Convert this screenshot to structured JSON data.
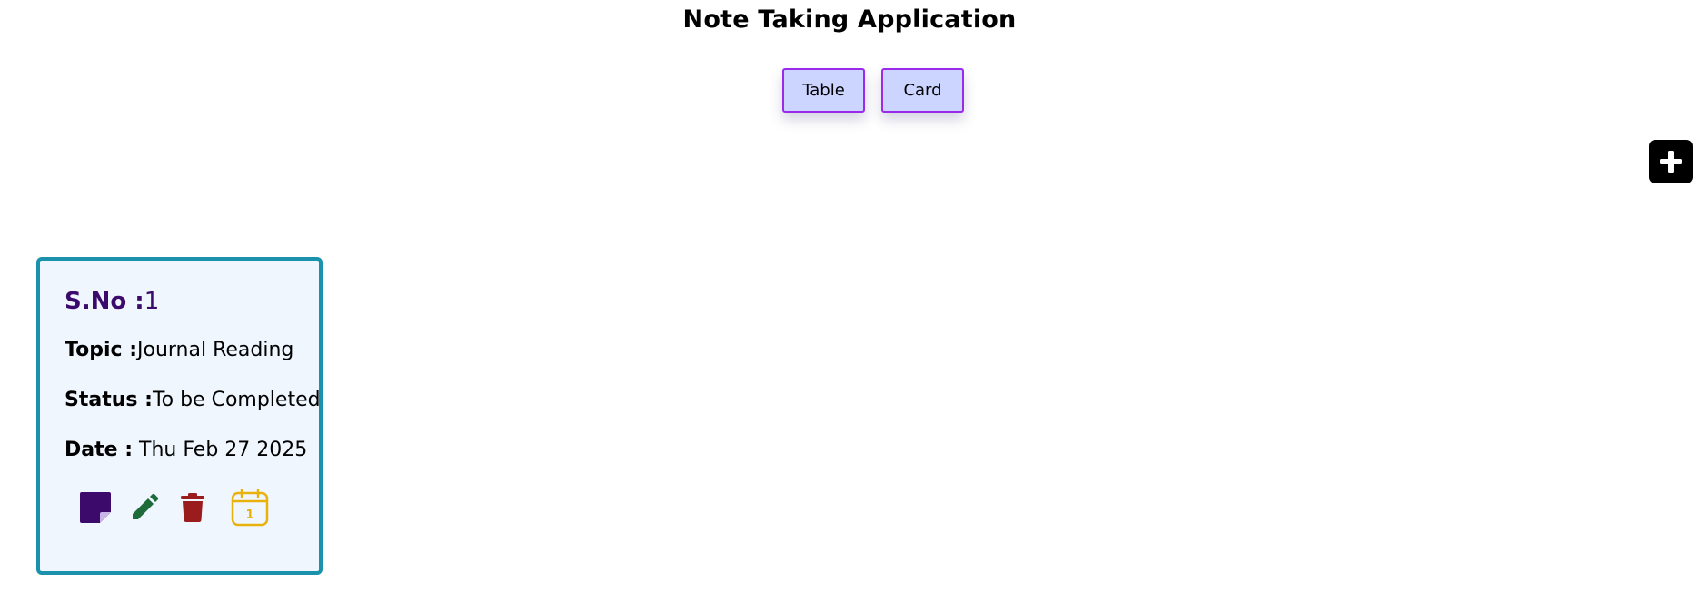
{
  "app": {
    "title": "Note Taking Application"
  },
  "view_toggle": {
    "table_label": "Table",
    "card_label": "Card"
  },
  "add_button": {
    "icon": "plus-icon"
  },
  "cards": [
    {
      "sno_label": "S.No :",
      "sno_value": "1",
      "topic_label": "Topic :",
      "topic_value": "Journal Reading",
      "status_label": "Status :",
      "status_value": "To be Completed",
      "date_label": "Date :",
      "date_value": " Thu Feb 27 2025",
      "actions": {
        "note_icon": "sticky-note-icon",
        "edit_icon": "pencil-icon",
        "delete_icon": "trash-icon",
        "calendar_icon": "calendar-icon",
        "calendar_day": "1"
      }
    }
  ],
  "colors": {
    "button_bg": "#ccd5ff",
    "button_border": "#9b2bea",
    "card_bg": "#eff6fe",
    "card_border": "#1a91ad",
    "sno_color": "#3b0a6b",
    "note_icon": "#3b0a6b",
    "edit_icon": "#1e6b3a",
    "delete_icon": "#9b1c1c",
    "calendar_icon": "#e9b10c"
  }
}
